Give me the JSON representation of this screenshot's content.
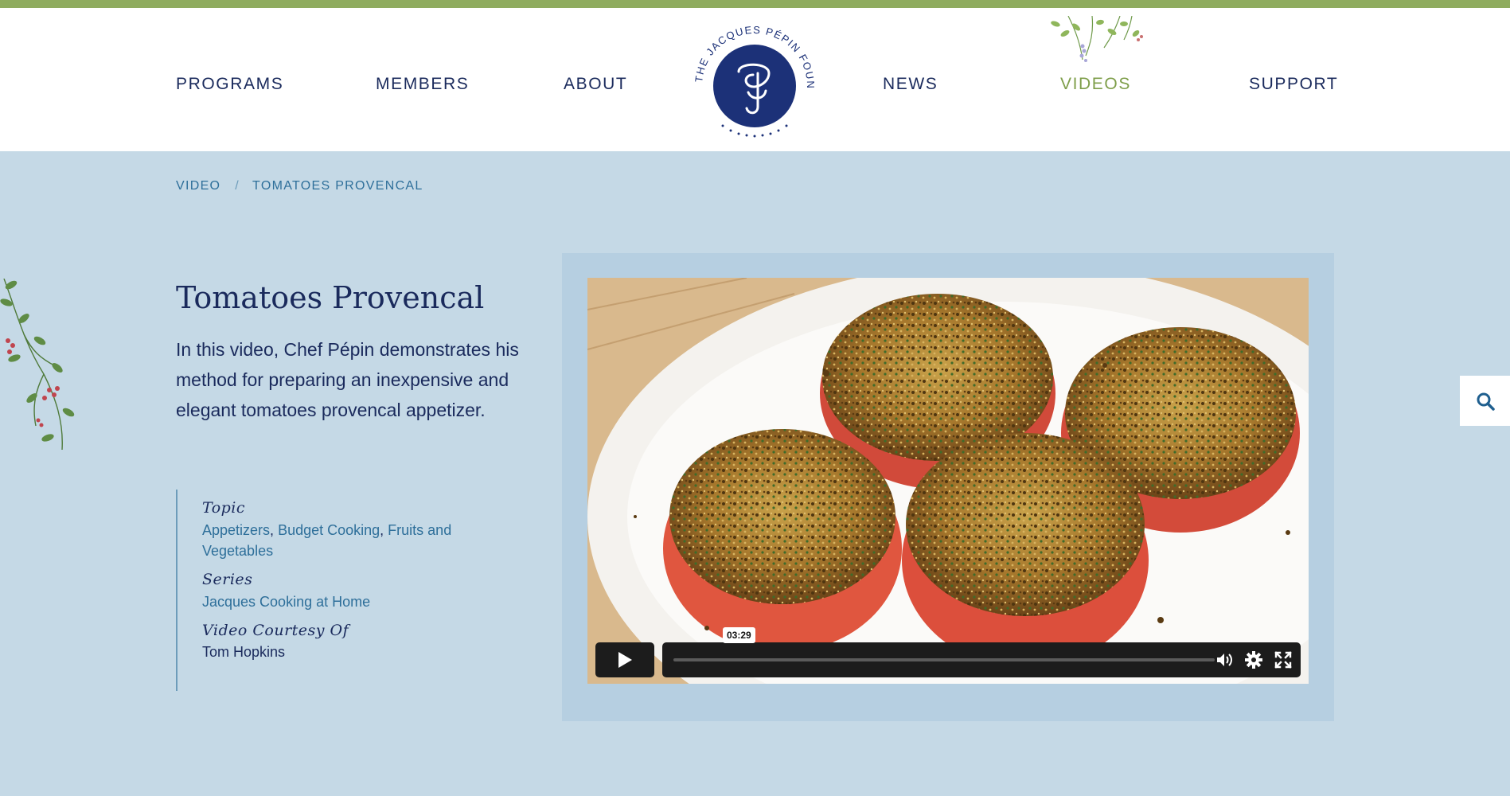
{
  "nav": {
    "items": [
      {
        "label": "PROGRAMS"
      },
      {
        "label": "MEMBERS"
      },
      {
        "label": "ABOUT"
      },
      {
        "label": "NEWS"
      },
      {
        "label": "VIDEOS"
      },
      {
        "label": "SUPPORT"
      }
    ],
    "active": "VIDEOS",
    "logo_text": "THE JACQUES PÉPIN FOUNDATION"
  },
  "breadcrumb": {
    "root": "VIDEO",
    "separator": "/",
    "current": "TOMATOES PROVENCAL"
  },
  "video_page": {
    "title": "Tomatoes Provencal",
    "description": "In this video, Chef Pépin demonstrates his method for preparing an inexpensive and elegant tomatoes provencal appetizer.",
    "meta": {
      "topic_label": "Topic",
      "topics": [
        "Appetizers",
        "Budget Cooking",
        "Fruits and Vegetables"
      ],
      "series_label": "Series",
      "series": "Jacques Cooking at Home",
      "courtesy_label": "Video Courtesy Of",
      "courtesy": "Tom Hopkins"
    }
  },
  "player": {
    "duration": "03:29",
    "progress_fraction": 0.0
  },
  "icons": {
    "search": "search-icon",
    "play": "play-icon",
    "volume": "volume-icon",
    "settings": "gear-icon",
    "fullscreen": "fullscreen-icon"
  },
  "colors": {
    "accent_green": "#8fac5f",
    "active_nav": "#7e9e4a",
    "navy": "#1a2a5c",
    "link_blue": "#2e6f9a",
    "page_bg": "#c5d9e6"
  }
}
